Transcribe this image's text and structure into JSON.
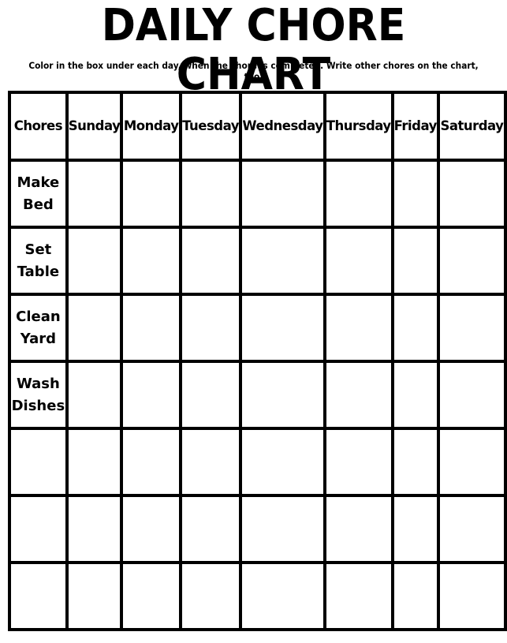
{
  "title": "DAILY CHORE CHART",
  "instructions": "Color in the box under each day, when the chore is completed. Write other chores on the chart, too.",
  "table": {
    "headers": [
      "Chores",
      "Sunday",
      "Monday",
      "Tuesday",
      "Wednesday",
      "Thursday",
      "Friday",
      "Saturday"
    ],
    "rows": [
      {
        "chore": [
          "Make",
          "Bed"
        ]
      },
      {
        "chore": [
          "Set",
          "Table"
        ]
      },
      {
        "chore": [
          "Clean",
          "Yard"
        ]
      },
      {
        "chore": [
          "Wash",
          "Dishes"
        ]
      },
      {
        "chore": [
          "",
          ""
        ]
      },
      {
        "chore": [
          "",
          ""
        ]
      },
      {
        "chore": [
          "",
          ""
        ]
      }
    ]
  }
}
